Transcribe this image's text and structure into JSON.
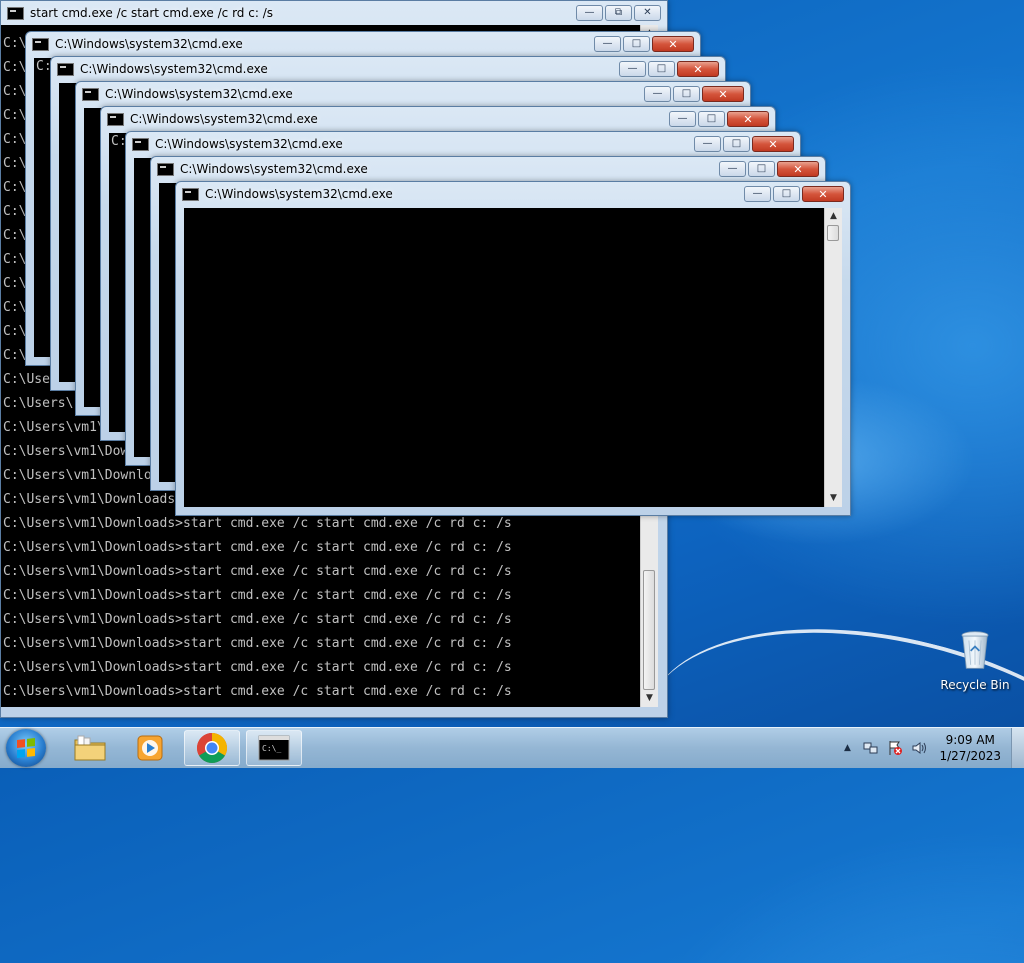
{
  "base_window": {
    "title": "start  cmd.exe /c start cmd.exe /c rd c: /s",
    "lines": [
      "C:\\",
      "C:\\",
      "C:\\",
      "C:\\",
      "C:\\",
      "C:\\",
      "C:\\",
      "C:\\",
      "C:\\",
      "C:\\",
      "C:\\",
      "C:\\",
      "C:\\",
      "C:\\",
      "C:\\Use",
      "C:\\Users\\",
      "C:\\Users\\vm1\\",
      "C:\\Users\\vm1\\Dow",
      "C:\\Users\\vm1\\Downlo",
      "C:\\Users\\vm1\\Downloads",
      "C:\\Users\\vm1\\Downloads>start cmd.exe /c start cmd.exe /c rd c: /s",
      "C:\\Users\\vm1\\Downloads>start cmd.exe /c start cmd.exe /c rd c: /s",
      "C:\\Users\\vm1\\Downloads>start cmd.exe /c start cmd.exe /c rd c: /s",
      "C:\\Users\\vm1\\Downloads>start cmd.exe /c start cmd.exe /c rd c: /s",
      "C:\\Users\\vm1\\Downloads>start cmd.exe /c start cmd.exe /c rd c: /s",
      "C:\\Users\\vm1\\Downloads>start cmd.exe /c start cmd.exe /c rd c: /s",
      "C:\\Users\\vm1\\Downloads>start cmd.exe /c start cmd.exe /c rd c: /s",
      "C:\\Users\\vm1\\Downloads>start cmd.exe /c start cmd.exe /c rd c: /s"
    ]
  },
  "cascade_windows": [
    {
      "title": "C:\\Windows\\system32\\cmd.exe",
      "line": "C:"
    },
    {
      "title": "C:\\Windows\\system32\\cmd.exe",
      "line": ""
    },
    {
      "title": "C:\\Windows\\system32\\cmd.exe",
      "line": ""
    },
    {
      "title": "C:\\Windows\\system32\\cmd.exe",
      "line": "C:"
    },
    {
      "title": "C:\\Windows\\system32\\cmd.exe",
      "line": ""
    },
    {
      "title": "C:\\Windows\\system32\\cmd.exe",
      "line": ""
    },
    {
      "title": "C:\\Windows\\system32\\cmd.exe",
      "line": ""
    }
  ],
  "window_controls": {
    "minimize": "—",
    "maximize": "□",
    "close": "✕"
  },
  "desktop": {
    "recycle_bin_label": "Recycle Bin"
  },
  "taskbar": {
    "pinned": [
      "windows-explorer",
      "media-player",
      "chrome",
      "command-prompt"
    ],
    "clock_time": "9:09 AM",
    "clock_date": "1/27/2023",
    "tray_chevron": "▲",
    "tray_icons": [
      "network-icon",
      "action-center-flag-icon",
      "volume-icon"
    ]
  },
  "colors": {
    "console_bg": "#000000",
    "console_text": "#c0c0c0",
    "close_red": "#c23a22"
  }
}
